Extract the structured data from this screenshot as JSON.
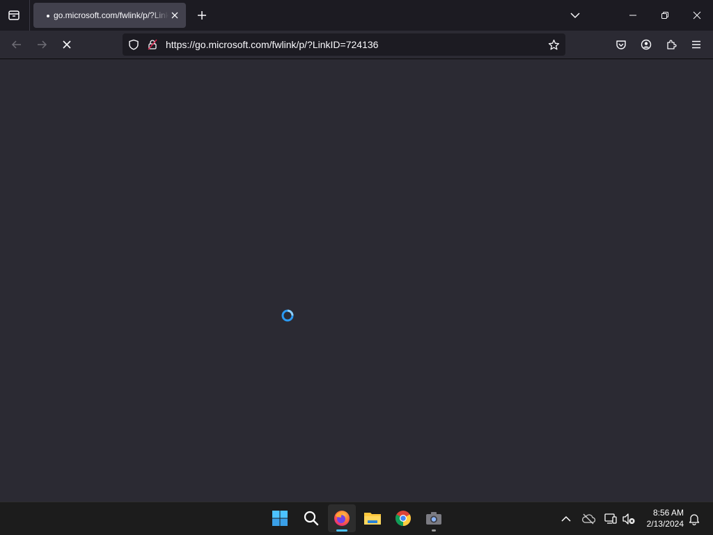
{
  "browser": {
    "tab": {
      "title": "go.microsoft.com/fwlink/p/?LinkID=724136"
    },
    "url": "https://go.microsoft.com/fwlink/p/?LinkID=724136"
  },
  "icons": {
    "tab_list": "tab-list-icon",
    "tab_close": "close-icon",
    "new_tab": "plus-icon",
    "list_all_tabs": "chevron-down-icon",
    "back": "arrow-left-icon",
    "forward": "arrow-right-icon",
    "stop": "stop-icon",
    "tracking": "shield-icon",
    "permissions": "lock-icon",
    "bookmark": "star-icon",
    "pocket": "pocket-icon",
    "account": "account-icon",
    "extensions": "puzzle-icon",
    "menu": "hamburger-menu-icon"
  },
  "taskbar": {
    "apps": [
      "start",
      "search",
      "firefox",
      "file-explorer",
      "chrome",
      "camera"
    ],
    "clock": {
      "time": "8:56 AM",
      "date": "2/13/2024"
    }
  },
  "colors": {
    "accent": "#4cc2ff",
    "spinner": "#2b9af3",
    "toolbar": "#2b2a33",
    "tabbar": "#1c1b22"
  }
}
